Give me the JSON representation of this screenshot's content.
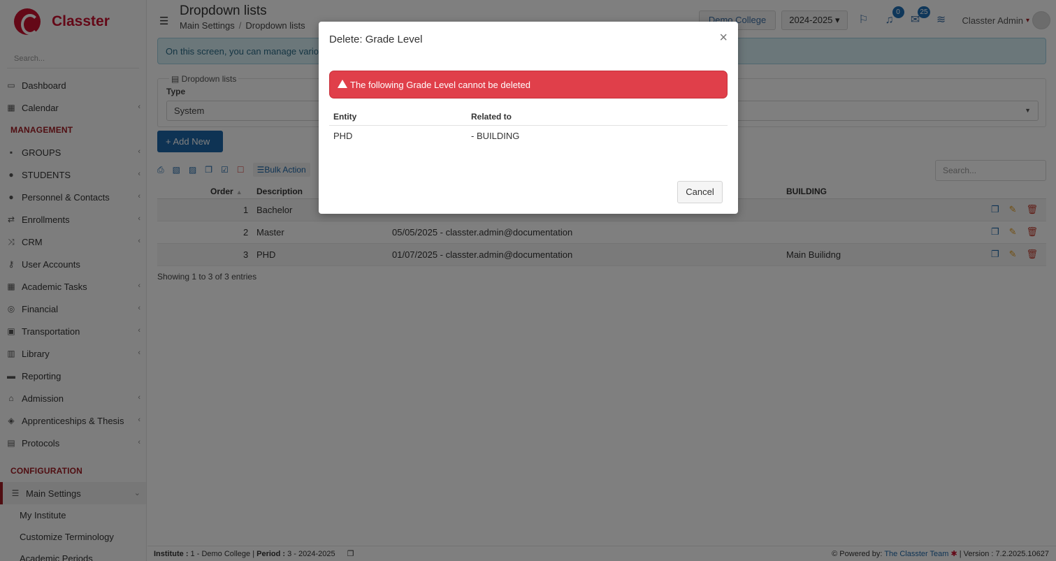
{
  "sidebar": {
    "brand": "Classter",
    "search_placeholder": "Search...",
    "items_top": [
      {
        "label": "Dashboard",
        "icon": "laptop-icon",
        "chevron": false
      },
      {
        "label": "Calendar",
        "icon": "calendar-icon",
        "chevron": true
      }
    ],
    "section_management": "MANAGEMENT",
    "items_management": [
      {
        "label": "GROUPS",
        "icon": "groups-icon",
        "chevron": true
      },
      {
        "label": "STUDENTS",
        "icon": "students-icon",
        "chevron": true
      },
      {
        "label": "Personnel & Contacts",
        "icon": "person-icon",
        "chevron": true
      },
      {
        "label": "Enrollments",
        "icon": "exchange-icon",
        "chevron": true
      },
      {
        "label": "CRM",
        "icon": "shuffle-icon",
        "chevron": true
      },
      {
        "label": "User Accounts",
        "icon": "key-icon",
        "chevron": false
      },
      {
        "label": "Academic Tasks",
        "icon": "grid-icon",
        "chevron": true
      },
      {
        "label": "Financial",
        "icon": "coins-icon",
        "chevron": true
      },
      {
        "label": "Transportation",
        "icon": "bus-icon",
        "chevron": true
      },
      {
        "label": "Library",
        "icon": "books-icon",
        "chevron": true
      },
      {
        "label": "Reporting",
        "icon": "printer-icon",
        "chevron": false
      },
      {
        "label": "Admission",
        "icon": "bank-icon",
        "chevron": true
      },
      {
        "label": "Apprenticeships & Thesis",
        "icon": "cube-icon",
        "chevron": true
      },
      {
        "label": "Protocols",
        "icon": "protocol-icon",
        "chevron": true
      }
    ],
    "section_configuration": "CONFIGURATION",
    "main_settings": "Main Settings",
    "sub_items": [
      "My Institute",
      "Customize Terminology",
      "Academic Periods"
    ]
  },
  "header": {
    "title": "Dropdown lists",
    "breadcrumb": [
      "Main Settings",
      "Dropdown lists"
    ],
    "college": "Demo College",
    "year": "2024-2025",
    "notifications_count": "0",
    "messages_count": "25",
    "user": "Classter Admin"
  },
  "info_text": "On this screen, you can manage vario",
  "filter": {
    "legend": "Dropdown lists",
    "type_label": "Type",
    "type_value": "System"
  },
  "add_new_label": "Add New",
  "bulk_actions_label": "Bulk Action",
  "table_search_placeholder": "Search...",
  "table": {
    "headers": {
      "order": "Order",
      "description": "Description",
      "building": "BUILDING"
    },
    "rows": [
      {
        "order": "1",
        "description": "Bachelor",
        "modified": "",
        "building": ""
      },
      {
        "order": "2",
        "description": "Master",
        "modified": "05/05/2025 - classter.admin@documentation",
        "building": ""
      },
      {
        "order": "3",
        "description": "PHD",
        "modified": "01/07/2025 - classter.admin@documentation",
        "building": "Main Builidng"
      }
    ],
    "showing": "Showing 1 to 3 of 3 entries"
  },
  "footer": {
    "institute_label": "Institute :",
    "institute_value": " 1 - Demo College | ",
    "period_label": "Period :",
    "period_value": " 3 - 2024-2025",
    "powered_by": "Powered by: ",
    "team": "The Classter Team",
    "version": " | Version : 7.2.2025.10627"
  },
  "modal": {
    "title": "Delete: Grade Level",
    "alert": "The following Grade Level cannot be deleted",
    "col_entity": "Entity",
    "col_related": "Related to",
    "rows": [
      {
        "entity": "PHD",
        "related": "- BUILDING"
      }
    ],
    "cancel_label": "Cancel"
  },
  "colors": {
    "brand": "#c8102e",
    "primary": "#1c66a8",
    "danger": "#e03f4a"
  }
}
